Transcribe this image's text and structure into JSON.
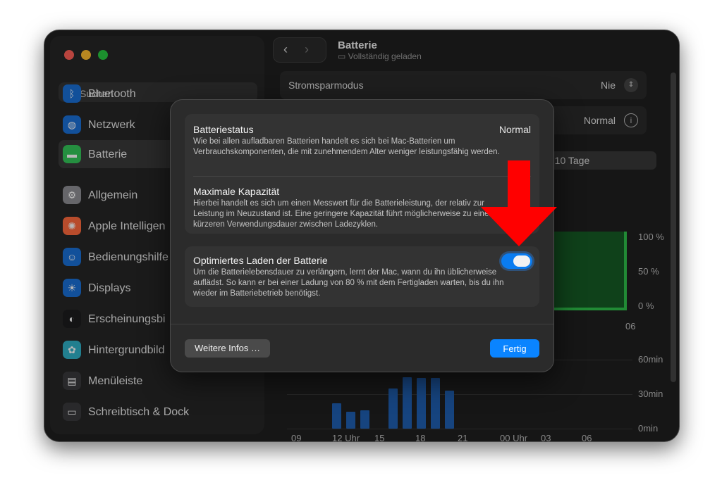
{
  "window": {
    "title": "Batterie",
    "subtitle": "Vollständig geladen"
  },
  "sidebar": {
    "search_label": "Suchen",
    "items": [
      {
        "label": "Bluetooth",
        "icon": "bluetooth-icon",
        "color": "#1a6fd6"
      },
      {
        "label": "Netzwerk",
        "icon": "globe-icon",
        "color": "#1a6fd6"
      },
      {
        "label": "Batterie",
        "icon": "battery-icon",
        "color": "#34c759",
        "selected": true
      },
      {
        "label": "Allgemein",
        "icon": "gear-icon",
        "color": "#8e8e93"
      },
      {
        "label": "Apple Intelligen",
        "icon": "apple-intelligence-icon",
        "color": "#ff6a3d"
      },
      {
        "label": "Bedienungshilfe",
        "icon": "accessibility-icon",
        "color": "#1a6fd6"
      },
      {
        "label": "Displays",
        "icon": "sun-icon",
        "color": "#1a6fd6"
      },
      {
        "label": "Erscheinungsbi",
        "icon": "appearance-icon",
        "color": "#1c1c1e"
      },
      {
        "label": "Hintergrundbild",
        "icon": "flower-icon",
        "color": "#30b0c7"
      },
      {
        "label": "Menüleiste",
        "icon": "menubar-icon",
        "color": "#3a3a3c"
      },
      {
        "label": "Schreibtisch & Dock",
        "icon": "dock-icon",
        "color": "#3a3a3c"
      }
    ]
  },
  "main": {
    "low_power_label": "Stromsparmodus",
    "low_power_value": "Nie",
    "health_value": "Normal",
    "segment_label": "n 10 Tage",
    "level_axis": [
      "100 %",
      "50 %",
      "0 %"
    ],
    "level_x_label": "06",
    "usage_axis": [
      "60min",
      "30min",
      "0min"
    ],
    "usage_x_labels": [
      "09",
      "12 Uhr",
      "15",
      "18",
      "21",
      "00 Uhr",
      "03",
      "06"
    ],
    "usage_values_min": [
      22,
      15,
      16,
      35,
      45,
      44,
      44,
      33
    ]
  },
  "sheet": {
    "sections": [
      {
        "title": "Batteriestatus",
        "value": "Normal",
        "text": "Wie bei allen aufladbaren Batterien handelt es sich bei Mac-Batterien um Verbrauchskomponenten, die mit zunehmendem Alter weniger leistungsfähig werden."
      },
      {
        "title": "Maximale Kapazität",
        "text": "Hierbei handelt es sich um einen Messwert für die Batterieleistung, der relativ zur Leistung im Neuzustand ist. Eine geringere Kapazität führt möglicherweise zu einer kürzeren Verwendungsdauer zwischen Ladezyklen."
      },
      {
        "title": "Optimiertes Laden der Batterie",
        "text": "Um die Batterielebensdauer zu verlängern, lernt der Mac, wann du ihn üblicherweise auflädst. So kann er bei einer Ladung von 80 % mit dem Fertigladen warten, bis du ihn wieder im Batteriebetrieb benötigst.",
        "toggle_on": true
      }
    ],
    "more_info_label": "Weitere Infos …",
    "done_label": "Fertig"
  },
  "colors": {
    "accent": "#0a84ff",
    "arrow": "#ff0000",
    "battery_green": "#2fbf4a",
    "usage_blue": "#1f5fb0"
  }
}
